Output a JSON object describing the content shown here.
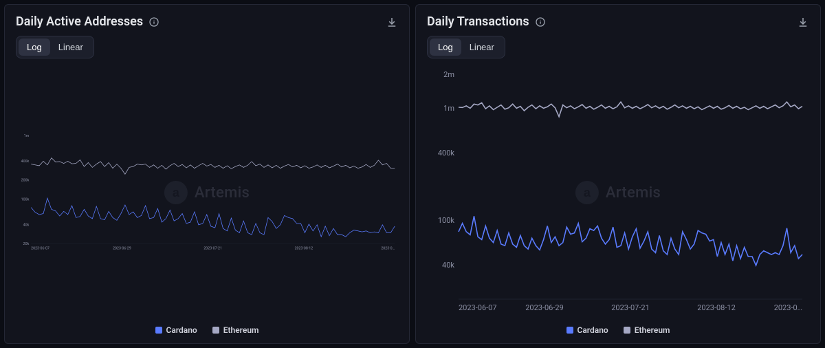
{
  "watermark": "Artemis",
  "scale": {
    "log": "Log",
    "linear": "Linear",
    "active": "log"
  },
  "legend": {
    "cardano": "Cardano",
    "ethereum": "Ethereum"
  },
  "panels": [
    {
      "id": "daa",
      "title": "Daily Active Addresses",
      "chart_data": {
        "type": "line",
        "scale": "log",
        "ylim": [
          20000,
          1000000
        ],
        "y_ticks": [
          20000,
          40000,
          100000,
          200000,
          400000,
          1000000
        ],
        "y_tick_labels": [
          "20k",
          "40k",
          "100k",
          "200k",
          "400k",
          "1m"
        ],
        "x": [
          "2023-06-07",
          "2023-06-08",
          "2023-06-09",
          "2023-06-10",
          "2023-06-11",
          "2023-06-12",
          "2023-06-13",
          "2023-06-14",
          "2023-06-15",
          "2023-06-16",
          "2023-06-17",
          "2023-06-18",
          "2023-06-19",
          "2023-06-20",
          "2023-06-21",
          "2023-06-22",
          "2023-06-23",
          "2023-06-24",
          "2023-06-25",
          "2023-06-26",
          "2023-06-27",
          "2023-06-28",
          "2023-06-29",
          "2023-06-30",
          "2023-07-01",
          "2023-07-02",
          "2023-07-03",
          "2023-07-04",
          "2023-07-05",
          "2023-07-06",
          "2023-07-07",
          "2023-07-08",
          "2023-07-09",
          "2023-07-10",
          "2023-07-11",
          "2023-07-12",
          "2023-07-13",
          "2023-07-14",
          "2023-07-15",
          "2023-07-16",
          "2023-07-17",
          "2023-07-18",
          "2023-07-19",
          "2023-07-20",
          "2023-07-21",
          "2023-07-22",
          "2023-07-23",
          "2023-07-24",
          "2023-07-25",
          "2023-07-26",
          "2023-07-27",
          "2023-07-28",
          "2023-07-29",
          "2023-07-30",
          "2023-07-31",
          "2023-08-01",
          "2023-08-02",
          "2023-08-03",
          "2023-08-04",
          "2023-08-05",
          "2023-08-06",
          "2023-08-07",
          "2023-08-08",
          "2023-08-09",
          "2023-08-10",
          "2023-08-11",
          "2023-08-12",
          "2023-08-13",
          "2023-08-14",
          "2023-08-15",
          "2023-08-16",
          "2023-08-17",
          "2023-08-18",
          "2023-08-19",
          "2023-08-20",
          "2023-08-21",
          "2023-08-22",
          "2023-08-23",
          "2023-08-24",
          "2023-08-25",
          "2023-08-26",
          "2023-08-27",
          "2023-08-28",
          "2023-08-29",
          "2023-08-30",
          "2023-08-31",
          "2023-09-01",
          "2023-09-02",
          "2023-09-03",
          "2023-09-04"
        ],
        "x_ticks": [
          "2023-06-07",
          "2023-06-29",
          "2023-07-21",
          "2023-08-12",
          "2023-0…"
        ],
        "series": [
          {
            "name": "Cardano",
            "color": "#5a7bff",
            "values": [
              75000,
              63000,
              58000,
              60000,
              105000,
              70000,
              66000,
              55000,
              65000,
              58000,
              80000,
              52000,
              54000,
              70000,
              55000,
              50000,
              78000,
              50000,
              48000,
              65000,
              52000,
              47000,
              60000,
              82000,
              58000,
              64000,
              52000,
              56000,
              80000,
              50000,
              52000,
              72000,
              44000,
              50000,
              68000,
              46000,
              50000,
              60000,
              42000,
              44000,
              64000,
              40000,
              42000,
              58000,
              38000,
              36000,
              60000,
              35000,
              32000,
              51000,
              33000,
              30000,
              46000,
              30000,
              28000,
              42000,
              30000,
              28000,
              52000,
              45000,
              35000,
              40000,
              56000,
              52000,
              50000,
              42000,
              42000,
              30000,
              41000,
              32000,
              40000,
              26000,
              38000,
              27000,
              35000,
              28000,
              28000,
              26000,
              30000,
              33000,
              32000,
              31000,
              32000,
              30000,
              31000,
              30000,
              40000,
              30000,
              30000,
              38000
            ]
          },
          {
            "name": "Ethereum",
            "color": "#a5a8c4",
            "values": [
              360000,
              350000,
              340000,
              400000,
              350000,
              450000,
              390000,
              395000,
              370000,
              400000,
              365000,
              370000,
              420000,
              330000,
              380000,
              320000,
              360000,
              395000,
              330000,
              380000,
              310000,
              360000,
              310000,
              250000,
              320000,
              330000,
              360000,
              350000,
              360000,
              320000,
              350000,
              310000,
              345000,
              300000,
              340000,
              370000,
              330000,
              355000,
              315000,
              350000,
              310000,
              340000,
              370000,
              335000,
              355000,
              320000,
              345000,
              310000,
              340000,
              305000,
              330000,
              350000,
              320000,
              345000,
              395000,
              340000,
              360000,
              320000,
              350000,
              315000,
              345000,
              310000,
              335000,
              355000,
              325000,
              345000,
              315000,
              340000,
              310000,
              325000,
              350000,
              320000,
              345000,
              315000,
              335000,
              360000,
              325000,
              345000,
              315000,
              335000,
              310000,
              325000,
              355000,
              320000,
              345000,
              415000,
              350000,
              370000,
              310000,
              310000
            ]
          }
        ]
      }
    },
    {
      "id": "dtx",
      "title": "Daily Transactions",
      "chart_data": {
        "type": "line",
        "scale": "log",
        "ylim": [
          20000,
          2000000
        ],
        "y_ticks": [
          40000,
          100000,
          400000,
          1000000,
          2000000
        ],
        "y_tick_labels": [
          "40k",
          "100k",
          "400k",
          "1m",
          "2m"
        ],
        "x_ticks": [
          "2023-06-07",
          "2023-06-29",
          "2023-07-21",
          "2023-08-12",
          "2023-0…"
        ],
        "series": [
          {
            "name": "Cardano",
            "color": "#5a7bff",
            "values": [
              80000,
              95000,
              80000,
              75000,
              110000,
              72000,
              68000,
              90000,
              70000,
              64000,
              82000,
              62000,
              60000,
              78000,
              62000,
              58000,
              74000,
              60000,
              56000,
              70000,
              60000,
              55000,
              68000,
              90000,
              64000,
              72000,
              60000,
              64000,
              88000,
              76000,
              78000,
              95000,
              65000,
              70000,
              85000,
              82000,
              90000,
              70000,
              62000,
              68000,
              88000,
              58000,
              60000,
              78000,
              56000,
              72000,
              85000,
              57000,
              66000,
              80000,
              56000,
              52000,
              74000,
              54000,
              50000,
              70000,
              56000,
              50000,
              80000,
              68000,
              56000,
              62000,
              82000,
              78000,
              76000,
              66000,
              68000,
              48000,
              64000,
              50000,
              62000,
              44000,
              60000,
              46000,
              58000,
              48000,
              48000,
              40000,
              50000,
              54000,
              52000,
              50000,
              52000,
              50000,
              60000,
              86000,
              52000,
              60000,
              46000,
              50000
            ]
          },
          {
            "name": "Ethereum",
            "color": "#a5a8c4",
            "values": [
              1030000,
              1025000,
              1060000,
              1010000,
              1100000,
              1080000,
              1130000,
              1000000,
              1060000,
              980000,
              1030000,
              1080000,
              990000,
              1020000,
              1100000,
              1010000,
              1050000,
              960000,
              1030000,
              1080000,
              1000000,
              1060000,
              1010000,
              1040000,
              1100000,
              1020000,
              850000,
              1080000,
              1020000,
              1060000,
              1000000,
              1040000,
              1090000,
              1010000,
              1050000,
              990000,
              1030000,
              1080000,
              1010000,
              1050000,
              1000000,
              1040000,
              1150000,
              1020000,
              1060000,
              1010000,
              1050000,
              1000000,
              1040000,
              1090000,
              1020000,
              1060000,
              1010000,
              1050000,
              990000,
              1030000,
              1080000,
              1020000,
              1060000,
              1010000,
              1050000,
              1000000,
              1040000,
              980000,
              1020000,
              1060000,
              1010000,
              1050000,
              990000,
              1020000,
              1070000,
              1010000,
              1050000,
              1000000,
              1030000,
              980000,
              1020000,
              1060000,
              1010000,
              1050000,
              1000000,
              1040000,
              1080000,
              1020000,
              1060000,
              1150000,
              1040000,
              1080000,
              1000000,
              1050000
            ]
          }
        ]
      }
    }
  ]
}
